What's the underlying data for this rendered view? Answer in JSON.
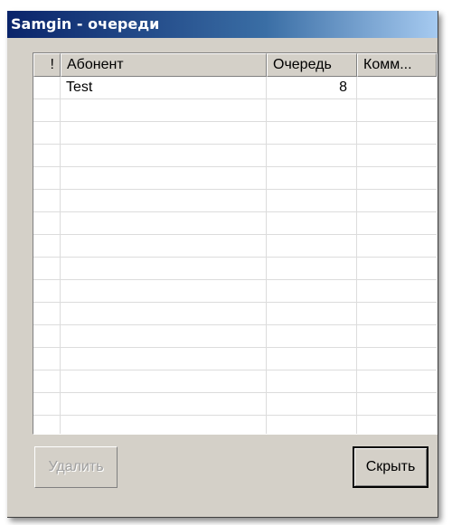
{
  "window": {
    "title": "Samgin - очереди"
  },
  "list": {
    "columns": {
      "priority": "!",
      "subscriber": "Абонент",
      "queue": "Очередь",
      "comment": "Комм..."
    },
    "rows": [
      {
        "priority": "",
        "subscriber": "Test",
        "queue": "8",
        "comment": ""
      }
    ],
    "empty_rows": 15
  },
  "buttons": {
    "delete_label": "Удалить",
    "hide_label": "Скрыть"
  },
  "colors": {
    "window_bg": "#d4d0c8",
    "titlebar_start": "#0a246a",
    "titlebar_end": "#a6caf0",
    "grid_line": "#dcdcdc",
    "disabled_text": "#a0a0a0"
  }
}
